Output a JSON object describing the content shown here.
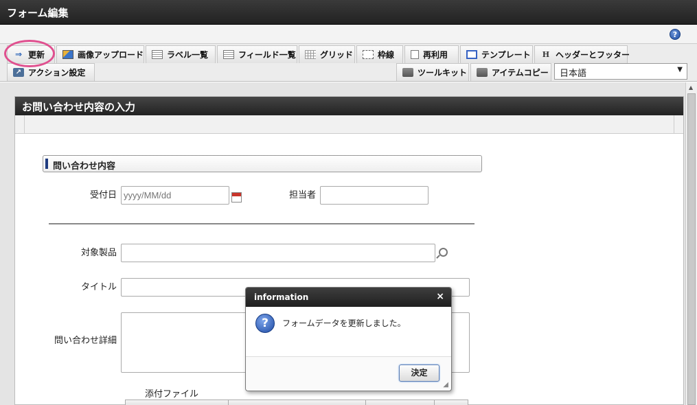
{
  "window": {
    "title": "フォーム編集"
  },
  "toolbar": {
    "row1": [
      {
        "label": "更新",
        "icon": "update-icon"
      },
      {
        "label": "画像アップロード",
        "icon": "image-upload-icon"
      },
      {
        "label": "ラベル一覧",
        "icon": "label-list-icon"
      },
      {
        "label": "フィールド一覧",
        "icon": "field-list-icon"
      },
      {
        "label": "グリッド",
        "icon": "grid-icon"
      },
      {
        "label": "枠線",
        "icon": "border-icon"
      },
      {
        "label": "再利用",
        "icon": "reuse-icon"
      },
      {
        "label": "テンプレート",
        "icon": "template-icon"
      },
      {
        "label": "ヘッダーとフッター",
        "icon": "header-footer-icon"
      }
    ],
    "row2_left": {
      "label": "アクション設定",
      "icon": "action-settings-icon"
    },
    "row2_right": [
      {
        "label": "ツールキット",
        "icon": "toolkit-icon"
      },
      {
        "label": "アイテムコピー",
        "icon": "item-copy-icon"
      }
    ],
    "language": "日本語"
  },
  "form": {
    "title": "お問い合わせ内容の入力",
    "section_title": "問い合わせ内容",
    "fields": {
      "received_date_label": "受付日",
      "received_date_placeholder": "yyyy/MM/dd",
      "assignee_label": "担当者",
      "product_label": "対象製品",
      "title_label": "タイトル",
      "details_label": "問い合わせ詳細",
      "attachment_label": "添付ファイル"
    }
  },
  "dialog": {
    "title": "information",
    "message": "フォームデータを更新しました。",
    "ok_label": "決定"
  },
  "colors": {
    "highlight": "#e0508f",
    "accent": "#1f3c7f"
  }
}
